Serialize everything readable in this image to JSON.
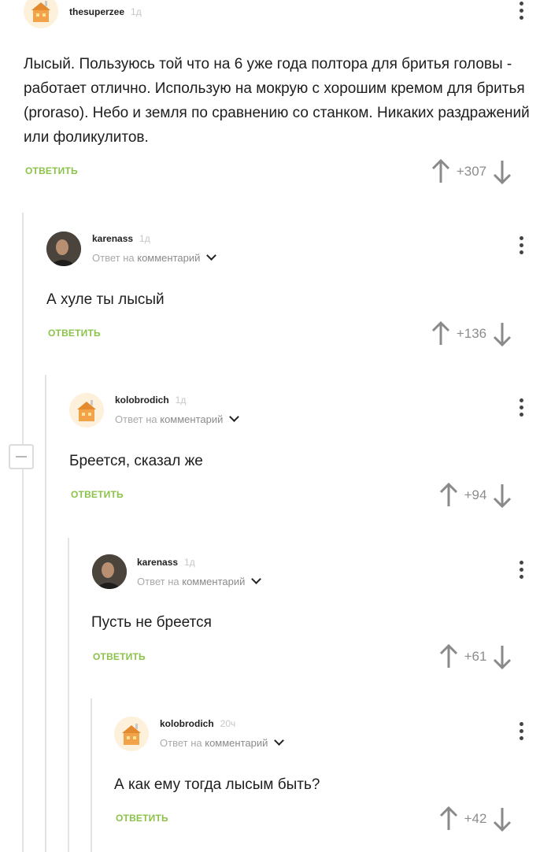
{
  "comments": [
    {
      "author": "thesuperzee",
      "time": "1д",
      "reply_to": "",
      "text": "Лысый. Пользуюсь той что на 6 уже года полтора для бритья головы - работает отлично. Использую на мокрую с хорошим кремом для бритья (proraso). Небо и земля по сравнению со станком. Никаких раздражений или фоликулитов.",
      "reply_label": "ОТВЕТИТЬ",
      "rating": "+307",
      "avatar": "house-avatar"
    },
    {
      "author": "karenass",
      "time": "1д",
      "reply_to_prefix": "Ответ на",
      "reply_to": "комментарий",
      "text": "А хуле ты лысый",
      "reply_label": "ОТВЕТИТЬ",
      "rating": "+136",
      "avatar": "photo-avatar"
    },
    {
      "author": "kolobrodich",
      "time": "1д",
      "reply_to_prefix": "Ответ на",
      "reply_to": "комментарий",
      "text": "Бреется, сказал же",
      "reply_label": "ОТВЕТИТЬ",
      "rating": "+94",
      "avatar": "house-avatar"
    },
    {
      "author": "karenass",
      "time": "1д",
      "reply_to_prefix": "Ответ на",
      "reply_to": "комментарий",
      "text": "Пусть не бреется",
      "reply_label": "ОТВЕТИТЬ",
      "rating": "+61",
      "avatar": "photo-avatar"
    },
    {
      "author": "kolobrodich",
      "time": "20ч",
      "reply_to_prefix": "Ответ на",
      "reply_to": "комментарий",
      "text": "А как ему тогда лысым быть?",
      "reply_label": "ОТВЕТИТЬ",
      "rating": "+42",
      "avatar": "house-avatar"
    }
  ],
  "colors": {
    "accent_green": "#8bc34a",
    "thread_line": "#e3e3e3",
    "muted_text": "#a9a9a9"
  }
}
